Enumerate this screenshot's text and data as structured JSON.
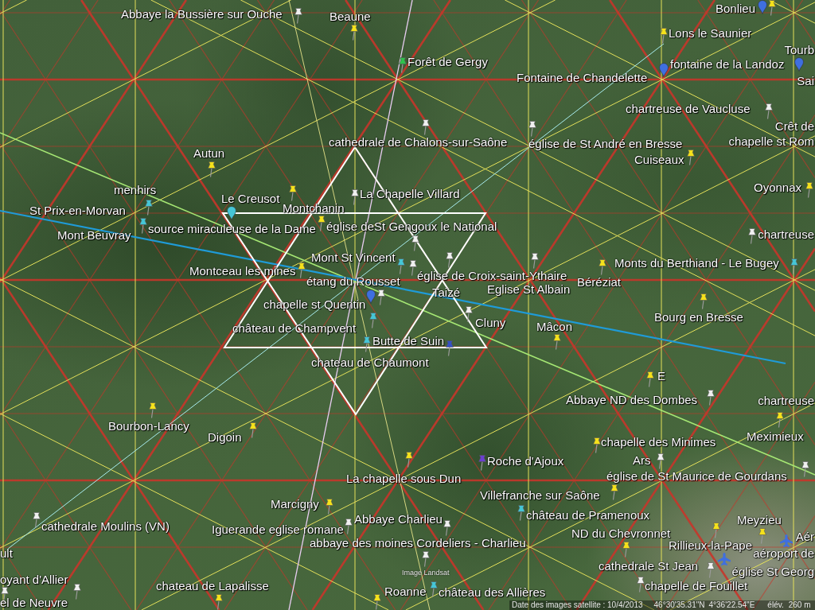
{
  "map": {
    "labels": [
      "Abbaye la Bussière sur Ouche",
      "Beaune",
      "Bonlieu",
      "Lons le Saunier",
      "Tourb",
      "Forêt de Gergy",
      "fontaine de la Landoz",
      "Fontaine de Chandelette",
      "Sai",
      "chartreuse de Vaucluse",
      "Crêt de",
      "cathedrale de Chalons-sur-Saône",
      "église de St André en Bresse",
      "chapelle st Rom",
      "Autun",
      "Cuiseaux",
      "menhirs",
      "Le Creusot",
      "La Chapelle Villard",
      "Oyonnax",
      "St Prix-en-Morvan",
      "Montchanin",
      "Mont Beuvray",
      "source miraculeuse de la Dame",
      "église deSt Gengoux le National",
      "chartreuse",
      "Mont St Vincent",
      "Monts du Berthiand - Le Bugey",
      "Montceau les mines",
      "étang du Rousset",
      "église de Croix-saint-Ythaire",
      "Taizé",
      "Eglise St Albain",
      "Béréziat",
      "chapelle st Quentin",
      "château de Champvent",
      "Cluny",
      "Mâcon",
      "Bourg en Bresse",
      "Butte de Suin",
      "chateau de Chaumont",
      "E",
      "Abbaye ND des Dombes",
      "chartreuse",
      "Bourbon-Lancy",
      "Digoin",
      "chapelle des Minimes",
      "Meximieux",
      "Roche d'Ajoux",
      "Ars",
      "La chapelle sous Dun",
      "église de St Maurice de Gourdans",
      "Marcigny",
      "Villefranche sur Saône",
      "cathedrale Moulins (VN)",
      "Iguerande eglise romane",
      "Abbaye Charlieu",
      "château de Pramenoux",
      "ND du Chevronnet",
      "Meyzieu",
      "Aér",
      "ult",
      "abbaye des moines Cordeliers - Charlieu",
      "Rillieux-la-Pape",
      "aéroport de",
      "cathedrale St Jean",
      "église St Georg",
      "oyant d'Allier",
      "chateau de Lapalisse",
      "Roanne",
      "château des Allières",
      "chapelle de Fouillet",
      "el de Neuvre"
    ],
    "pins": [
      {
        "kind": "pushpin",
        "color": "#f0f0f0"
      },
      {
        "kind": "pushpin",
        "color": "#f5e21b"
      },
      {
        "kind": "drop",
        "color": "#3f6fe0"
      },
      {
        "kind": "pushpin",
        "color": "#f5e21b"
      },
      {
        "kind": "pushpin",
        "color": "#f5e21b"
      },
      {
        "kind": "pushpin",
        "color": "#2fc24c"
      },
      {
        "kind": "drop",
        "color": "#3f6fe0"
      },
      {
        "kind": "drop",
        "color": "#3f6fe0"
      },
      {
        "kind": "pushpin",
        "color": "#f0f0f0"
      },
      {
        "kind": "pushpin",
        "color": "#f0f0f0"
      },
      {
        "kind": "pushpin",
        "color": "#f0f0f0"
      },
      {
        "kind": "pushpin",
        "color": "#f5e21b"
      },
      {
        "kind": "pushpin",
        "color": "#f5e21b"
      },
      {
        "kind": "pushpin",
        "color": "#f5e21b"
      },
      {
        "kind": "pushpin",
        "color": "#45c6d6"
      },
      {
        "kind": "pushpin",
        "color": "#f0f0f0"
      },
      {
        "kind": "pushpin",
        "color": "#f5e21b"
      },
      {
        "kind": "drop",
        "color": "#45c6d6"
      },
      {
        "kind": "pushpin",
        "color": "#45c6d6"
      },
      {
        "kind": "pushpin",
        "color": "#f5e21b"
      },
      {
        "kind": "pushpin",
        "color": "#f0f0f0"
      },
      {
        "kind": "pushpin",
        "color": "#f0f0f0"
      },
      {
        "kind": "pushpin",
        "color": "#45c6d6"
      },
      {
        "kind": "pushpin",
        "color": "#f5e21b"
      },
      {
        "kind": "pushpin",
        "color": "#45c6d6"
      },
      {
        "kind": "pushpin",
        "color": "#f5e21b"
      },
      {
        "kind": "pushpin",
        "color": "#f0f0f0"
      },
      {
        "kind": "pushpin",
        "color": "#f0f0f0"
      },
      {
        "kind": "pushpin",
        "color": "#f0f0f0"
      },
      {
        "kind": "drop",
        "color": "#3f6fe0"
      },
      {
        "kind": "pushpin",
        "color": "#f0f0f0"
      },
      {
        "kind": "pushpin",
        "color": "#f5e21b"
      },
      {
        "kind": "pushpin",
        "color": "#f0f0f0"
      },
      {
        "kind": "pushpin",
        "color": "#45c6d6"
      },
      {
        "kind": "pushpin",
        "color": "#f5e21b"
      },
      {
        "kind": "pushpin",
        "color": "#45c6d6"
      },
      {
        "kind": "pushpin",
        "color": "#3450c4"
      },
      {
        "kind": "pushpin",
        "color": "#f5e21b"
      },
      {
        "kind": "pushpin",
        "color": "#f0f0f0"
      },
      {
        "kind": "pushpin",
        "color": "#f5e21b"
      },
      {
        "kind": "pushpin",
        "color": "#f5e21b"
      },
      {
        "kind": "pushpin",
        "color": "#f5e21b"
      },
      {
        "kind": "pushpin",
        "color": "#f5e21b"
      },
      {
        "kind": "pushpin",
        "color": "#6a3fd0"
      },
      {
        "kind": "pushpin",
        "color": "#f5e21b"
      },
      {
        "kind": "pushpin",
        "color": "#f0f0f0"
      },
      {
        "kind": "pushpin",
        "color": "#f0f0f0"
      },
      {
        "kind": "pushpin",
        "color": "#f5e21b"
      },
      {
        "kind": "pushpin",
        "color": "#f5e21b"
      },
      {
        "kind": "pushpin",
        "color": "#45c6d6"
      },
      {
        "kind": "pushpin",
        "color": "#f0f0f0"
      },
      {
        "kind": "pushpin",
        "color": "#f0f0f0"
      },
      {
        "kind": "pushpin",
        "color": "#f0f0f0"
      },
      {
        "kind": "pushpin",
        "color": "#f5e21b"
      },
      {
        "kind": "pushpin",
        "color": "#f5e21b"
      },
      {
        "kind": "pushpin",
        "color": "#f5e21b"
      },
      {
        "kind": "airplane",
        "color": "#3f6fe0"
      },
      {
        "kind": "pushpin",
        "color": "#f0f0f0"
      },
      {
        "kind": "airplane",
        "color": "#3f6fe0"
      },
      {
        "kind": "pushpin",
        "color": "#f0f0f0"
      },
      {
        "kind": "pushpin",
        "color": "#f0f0f0"
      },
      {
        "kind": "pushpin",
        "color": "#f5e21b"
      },
      {
        "kind": "pushpin",
        "color": "#f0f0f0"
      },
      {
        "kind": "pushpin",
        "color": "#f0f0f0"
      },
      {
        "kind": "pushpin",
        "color": "#45c6d6"
      },
      {
        "kind": "pushpin",
        "color": "#f5e21b"
      }
    ],
    "credit": "Image Landsat"
  },
  "status_bar": {
    "imagery_date": "Date des images satellite : 10/4/2013",
    "latitude": "46°30'35.31\"N",
    "longitude": "4°36'22.54\"E",
    "elevation_label": "élév.",
    "elevation": "260 m"
  }
}
